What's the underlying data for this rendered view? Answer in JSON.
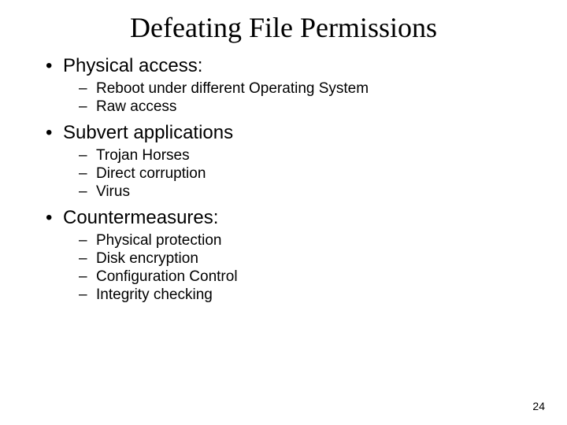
{
  "title": "Defeating File Permissions",
  "section1": {
    "heading": "Physical access:",
    "items": [
      "Reboot under different Operating System",
      "Raw access"
    ]
  },
  "section2": {
    "heading": "Subvert applications",
    "items": [
      "Trojan Horses",
      "Direct corruption",
      "Virus"
    ]
  },
  "section3": {
    "heading": "Countermeasures:",
    "items": [
      "Physical protection",
      "Disk encryption",
      "Configuration Control",
      "Integrity checking"
    ]
  },
  "page_number": "24"
}
